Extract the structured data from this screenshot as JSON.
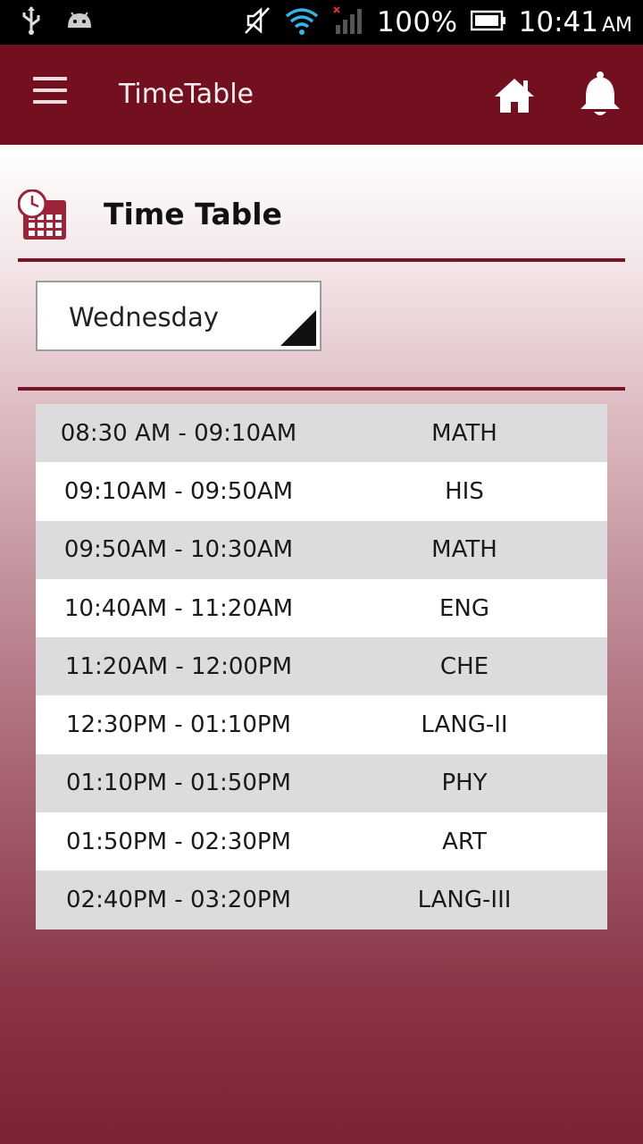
{
  "status_bar": {
    "battery_percent": "100%",
    "time": "10:41",
    "ampm": "AM",
    "icons": [
      "usb-icon",
      "android-icon",
      "mute-icon",
      "wifi-icon",
      "signal-icon",
      "battery-icon"
    ]
  },
  "app_bar": {
    "title": "TimeTable",
    "color": "#72101f",
    "icons": [
      "menu-icon",
      "home-icon",
      "bell-icon"
    ]
  },
  "section": {
    "title": "Time Table",
    "icon": "calendar-clock-icon"
  },
  "day_selector": {
    "selected": "Wednesday"
  },
  "timetable": [
    {
      "time": "08:30 AM - 09:10AM",
      "subject": "MATH"
    },
    {
      "time": "09:10AM - 09:50AM",
      "subject": "HIS"
    },
    {
      "time": "09:50AM - 10:30AM",
      "subject": "MATH"
    },
    {
      "time": "10:40AM - 11:20AM",
      "subject": "ENG"
    },
    {
      "time": "11:20AM - 12:00PM",
      "subject": "CHE"
    },
    {
      "time": "12:30PM - 01:10PM",
      "subject": "LANG-II"
    },
    {
      "time": "01:10PM - 01:50PM",
      "subject": "PHY"
    },
    {
      "time": "01:50PM - 02:30PM",
      "subject": "ART"
    },
    {
      "time": "02:40PM - 03:20PM",
      "subject": "LANG-III"
    }
  ]
}
